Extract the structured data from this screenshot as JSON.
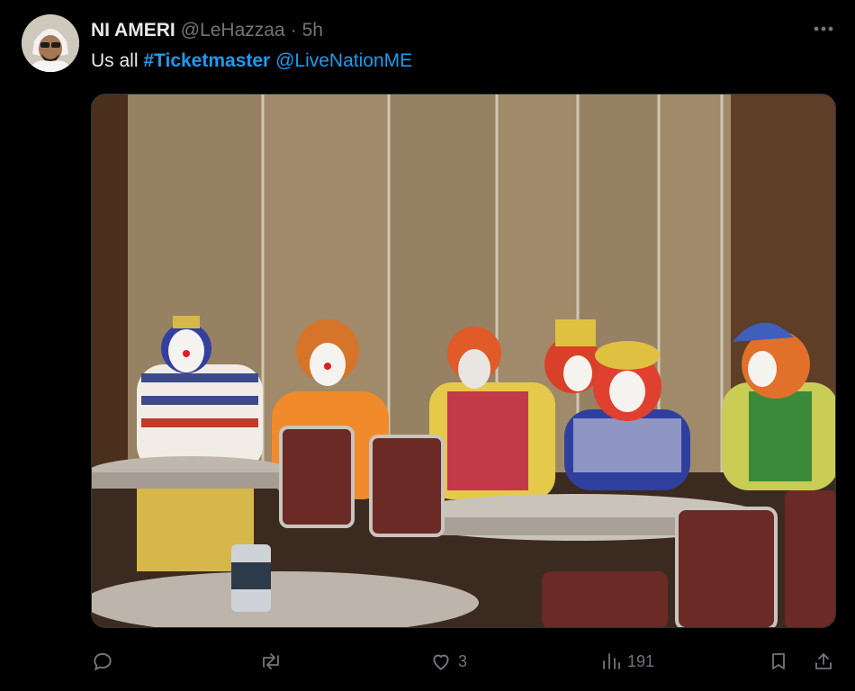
{
  "tweet": {
    "display_name": "NI AMERI",
    "handle": "@LeHazzaa",
    "separator": "·",
    "time": "5h",
    "text_prefix": "Us all",
    "hashtag": "#Ticketmaster",
    "mention": "@LiveNationME",
    "avatar_icon": "user-avatar",
    "more_icon": "more-dots-icon",
    "media_description_icon": "photo"
  },
  "actions": {
    "reply": {
      "icon": "reply-icon",
      "count": ""
    },
    "repost": {
      "icon": "repost-icon",
      "count": ""
    },
    "like": {
      "icon": "heart-icon",
      "count": "3"
    },
    "views": {
      "icon": "views-chart-icon",
      "count": "191"
    },
    "bookmark": {
      "icon": "bookmark-icon"
    },
    "share": {
      "icon": "share-icon"
    }
  },
  "colors": {
    "background": "#000000",
    "text": "#e7e9ea",
    "muted": "#71767b",
    "link": "#1d9bf0"
  }
}
